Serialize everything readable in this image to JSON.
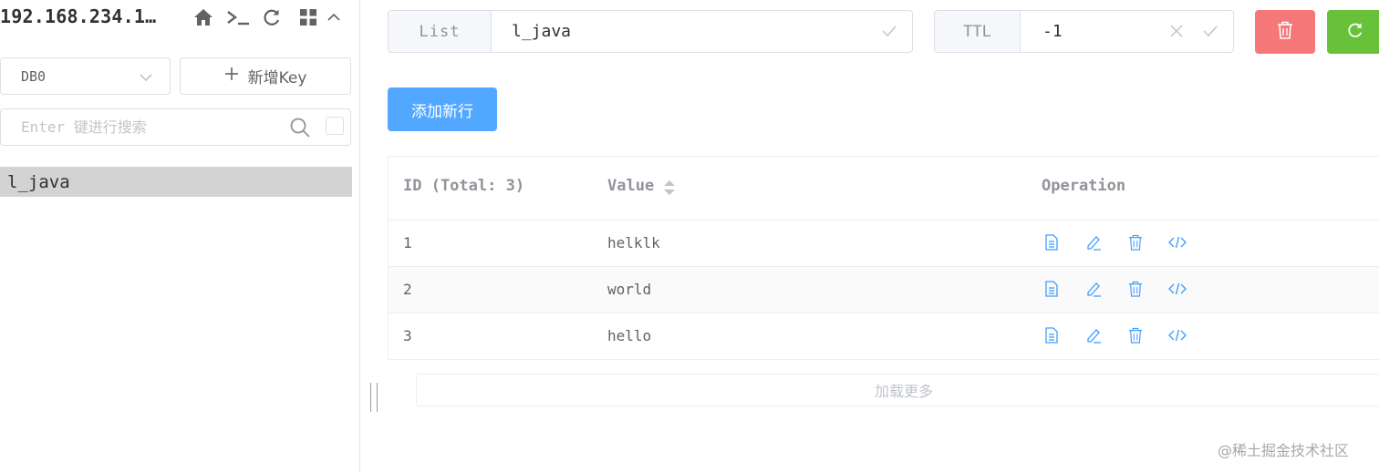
{
  "connection": {
    "name": "192.168.234.1…",
    "icons": [
      "home-icon",
      "terminal-icon",
      "refresh-icon",
      "grid-icon",
      "chevron-up-icon"
    ]
  },
  "sidebar": {
    "db_select": {
      "value": "DB0"
    },
    "new_key_label": "新增Key",
    "search": {
      "placeholder": "Enter 键进行搜索",
      "value": ""
    },
    "keys": [
      {
        "label": "l_java",
        "selected": true
      }
    ]
  },
  "key_detail": {
    "type_label": "List",
    "key_name": "l_java",
    "ttl_label": "TTL",
    "ttl_value": "-1"
  },
  "actions": {
    "add_row_label": "添加新行"
  },
  "table": {
    "headers": {
      "id": "ID (Total: 3)",
      "value": "Value",
      "operation": "Operation"
    },
    "rows": [
      {
        "id": "1",
        "value": "helklk"
      },
      {
        "id": "2",
        "value": "world"
      },
      {
        "id": "3",
        "value": "hello"
      }
    ],
    "row_operations": [
      "copy-icon",
      "edit-icon",
      "delete-icon",
      "code-icon"
    ]
  },
  "load_more_label": "加载更多",
  "watermark": "@稀土掘金技术社区",
  "colors": {
    "danger": "#f56c6c",
    "success": "#67c23a",
    "primary": "#409eff",
    "selected_key_bg": "#d3d3d3",
    "op_icon": "#409eff"
  }
}
